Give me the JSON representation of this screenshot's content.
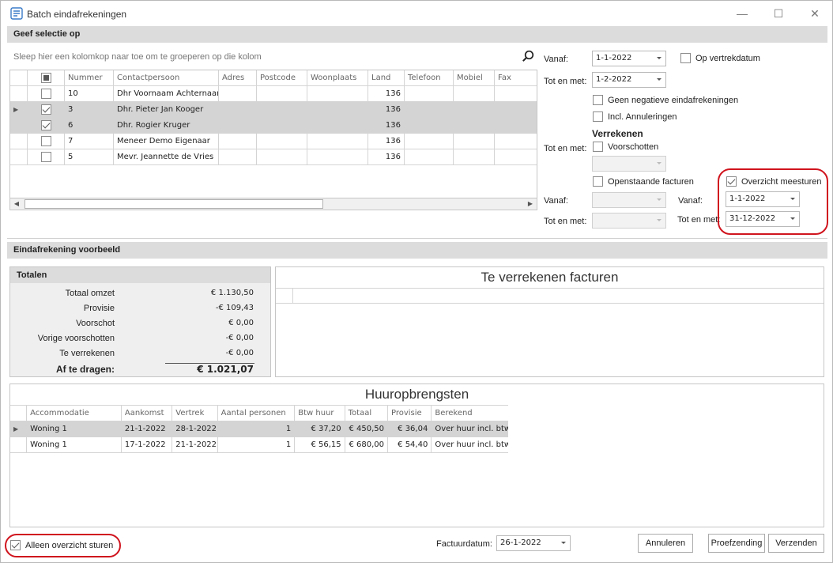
{
  "window": {
    "title": "Batch eindafrekeningen",
    "minimize": "—",
    "maximize": "☐",
    "close": "✕"
  },
  "selection": {
    "header": "Geef selectie op",
    "group_hint": "Sleep hier een kolomkop naar toe om te groeperen op die kolom",
    "columns": [
      "Nummer",
      "Contactpersoon",
      "Adres",
      "Postcode",
      "Woonplaats",
      "Land",
      "Telefoon",
      "Mobiel",
      "Fax"
    ],
    "rows": [
      {
        "checked": false,
        "selected": false,
        "current": false,
        "nummer": "10",
        "contact": "Dhr Voornaam Achternaam",
        "land": "136"
      },
      {
        "checked": true,
        "selected": true,
        "current": true,
        "nummer": "3",
        "contact": "Dhr. Pieter Jan Kooger",
        "land": "136"
      },
      {
        "checked": true,
        "selected": true,
        "current": false,
        "nummer": "6",
        "contact": "Dhr. Rogier Kruger",
        "land": "136"
      },
      {
        "checked": false,
        "selected": false,
        "current": false,
        "nummer": "7",
        "contact": "Meneer Demo  Eigenaar",
        "land": "136"
      },
      {
        "checked": false,
        "selected": false,
        "current": false,
        "nummer": "5",
        "contact": "Mevr. Jeannette de Vries",
        "land": "136"
      }
    ]
  },
  "filters": {
    "vanaf_label": "Vanaf:",
    "vanaf_value": "1-1-2022",
    "op_vertrekdatum": "Op vertrekdatum",
    "totenmet_label": "Tot en met:",
    "totenmet_value": "1-2-2022",
    "geen_negatieve": "Geen negatieve eindafrekeningen",
    "incl_annuleringen": "Incl. Annuleringen",
    "verrekenen_header": "Verrekenen",
    "verrekenen_totenmet_label": "Tot en met:",
    "voorschotten": "Voorschotten",
    "openstaande": "Openstaande facturen",
    "overzicht_meesturen": "Overzicht meesturen",
    "os_vanaf_label": "Vanaf:",
    "os_totenmet_label": "Tot en met:",
    "ov_vanaf_label": "Vanaf:",
    "ov_vanaf_value": "1-1-2022",
    "ov_totenmet_label": "Tot en met:",
    "ov_totenmet_value": "31-12-2022"
  },
  "preview": {
    "header": "Eindafrekening voorbeeld",
    "totalen": {
      "header": "Totalen",
      "rows": [
        {
          "label": "Totaal omzet",
          "value": "€ 1.130,50"
        },
        {
          "label": "Provisie",
          "value": "-€ 109,43"
        },
        {
          "label": "Voorschot",
          "value": "€ 0,00"
        },
        {
          "label": "Vorige voorschotten",
          "value": "-€ 0,00"
        },
        {
          "label": "Te verrekenen",
          "value": "-€ 0,00"
        }
      ],
      "af_te_dragen_label": "Af te dragen:",
      "af_te_dragen_value": "€ 1.021,07"
    },
    "te_verrekenen_title": "Te verrekenen facturen",
    "huur_title": "Huuropbrengsten",
    "huur_columns": [
      "Accommodatie",
      "Aankomst",
      "Vertrek",
      "Aantal personen",
      "Btw huur",
      "Totaal",
      "Provisie",
      "Berekend"
    ],
    "huur_rows": [
      {
        "acc": "Woning 1",
        "aankomst": "21-1-2022",
        "vertrek": "28-1-2022",
        "personen": "1",
        "btw": "€ 37,20",
        "totaal": "€ 450,50",
        "provisie": "€ 36,04",
        "berekend": "Over huur incl. btw"
      },
      {
        "acc": "Woning 1",
        "aankomst": "17-1-2022",
        "vertrek": "21-1-2022",
        "personen": "1",
        "btw": "€ 56,15",
        "totaal": "€ 680,00",
        "provisie": "€ 54,40",
        "berekend": "Over huur incl. btw"
      }
    ]
  },
  "footer": {
    "alleen_overzicht": "Alleen overzicht sturen",
    "factuurdatum_label": "Factuurdatum:",
    "factuurdatum_value": "26-1-2022",
    "annuleren": "Annuleren",
    "proefzending": "Proefzending",
    "verzenden": "Verzenden"
  },
  "colors": {
    "highlight": "#d0141e",
    "selected_row": "#d4d4d4",
    "group_header": "#dcdcdc"
  }
}
